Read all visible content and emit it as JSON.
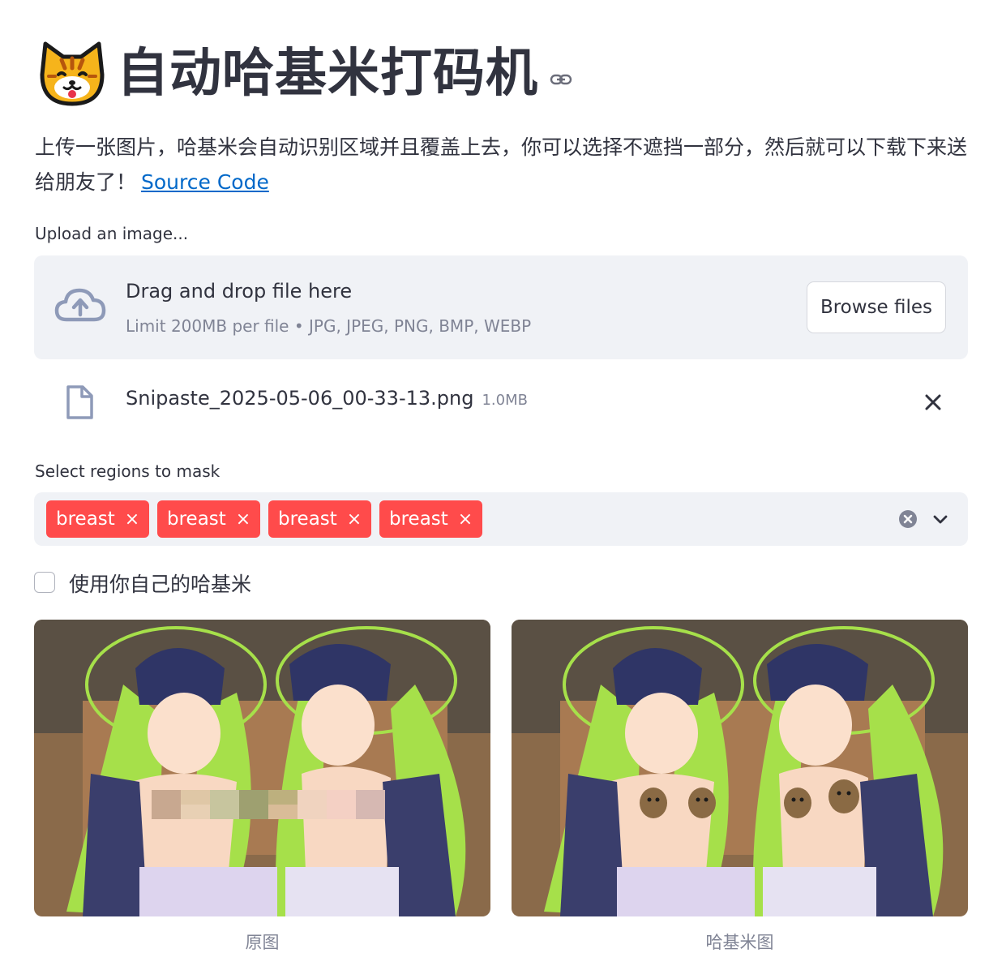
{
  "header": {
    "emoji": "cat-face-icon",
    "title": "自动哈基米打码机",
    "anchor_icon": "link-icon"
  },
  "description": {
    "text": "上传一张图片，哈基米会自动识别区域并且覆盖上去，你可以选择不遮挡一部分，然后就可以下载下来送给朋友了！",
    "link_label": "Source Code"
  },
  "uploader": {
    "label": "Upload an image...",
    "drag_title": "Drag and drop file here",
    "drag_subtitle": "Limit 200MB per file • JPG, JPEG, PNG, BMP, WEBP",
    "browse_label": "Browse files",
    "file": {
      "name": "Snipaste_2025-05-06_00-33-13.png",
      "size": "1.0MB"
    }
  },
  "mask_select": {
    "label": "Select regions to mask",
    "tags": [
      "breast",
      "breast",
      "breast",
      "breast"
    ],
    "tag_close": "×",
    "tag_color": "#ff4b4b"
  },
  "custom_hajimi": {
    "label": "使用你自己的哈基米",
    "checked": false
  },
  "images": {
    "left_caption": "原图",
    "right_caption": "哈基米图"
  },
  "colors": {
    "text": "#31333f",
    "muted": "#808495",
    "panel": "#f0f2f6",
    "link": "#0068c9"
  }
}
